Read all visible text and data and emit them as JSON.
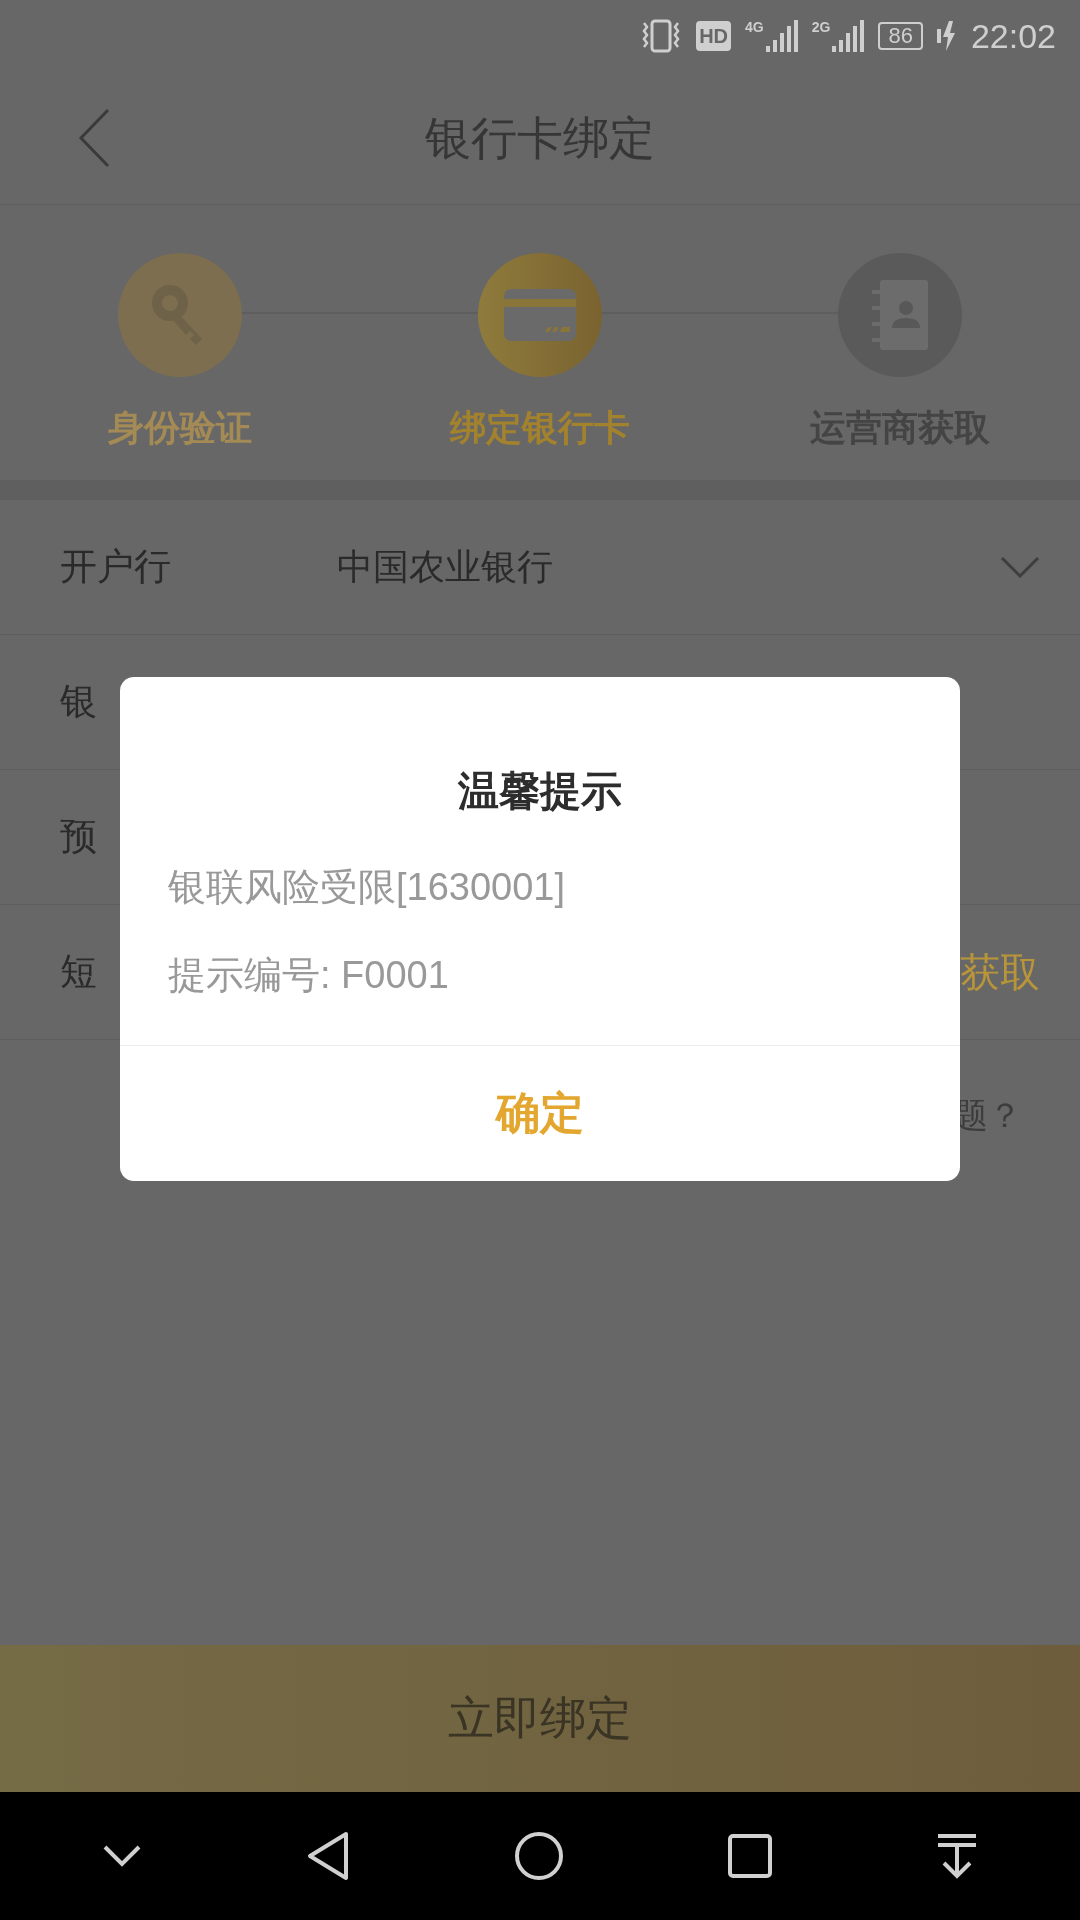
{
  "status_bar": {
    "hd": "HD",
    "network_1": "4G",
    "network_2": "2G",
    "battery": "86",
    "time": "22:02"
  },
  "header": {
    "title": "银行卡绑定"
  },
  "steps": [
    {
      "label": "身份验证",
      "completed": true,
      "selected": false
    },
    {
      "label": "绑定银行卡",
      "completed": false,
      "selected": true
    },
    {
      "label": "运营商获取",
      "completed": false,
      "selected": false
    }
  ],
  "form_rows": [
    {
      "label": "开户行",
      "value": "中国农业银行",
      "kind": "select"
    },
    {
      "label": "银",
      "kind": "text"
    },
    {
      "label": "预",
      "kind": "text"
    },
    {
      "label": "短",
      "action": "获取",
      "kind": "code"
    }
  ],
  "help_link": "题？",
  "primary_button": "立即绑定",
  "dialog": {
    "title": "温馨提示",
    "lines": [
      "银联风险受限[1630001]",
      "提示编号: F0001"
    ],
    "confirm": "确定"
  }
}
